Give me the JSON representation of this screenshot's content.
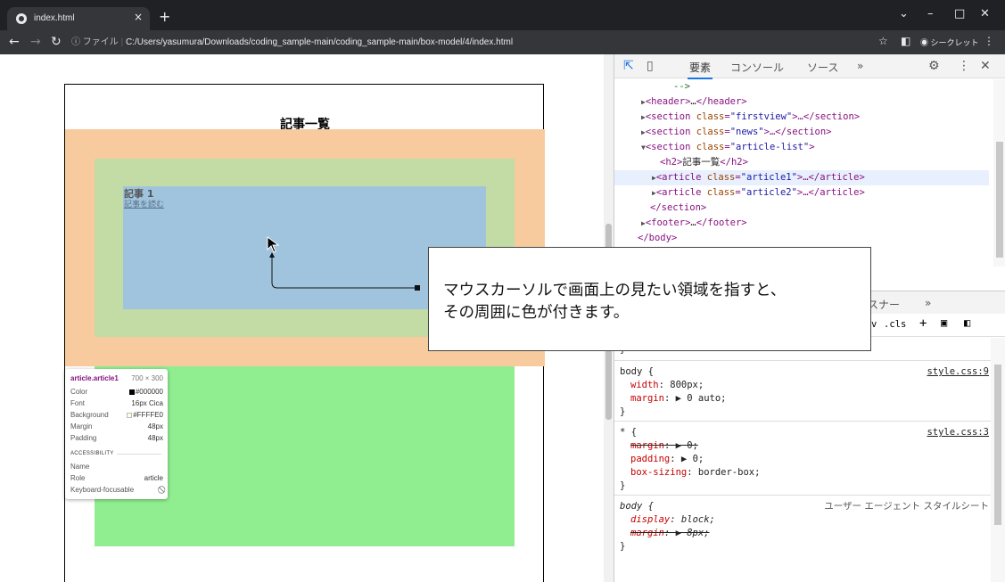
{
  "browser": {
    "tab_title": "index.html",
    "tab_close": "×",
    "new_tab": "+",
    "file_label": "ファイル",
    "url": "C:/Users/yasumura/Downloads/coding_sample-main/coding_sample-main/box-model/4/index.html",
    "incognito_label": "シークレット"
  },
  "page": {
    "heading": "記事一覧",
    "article_title": "記事 1",
    "article_link": "記事を読む"
  },
  "tooltip": {
    "selector": "article.article1",
    "size": "700 × 300",
    "rows": [
      {
        "k": "Color",
        "v": "#000000",
        "swatch": "#000000"
      },
      {
        "k": "Font",
        "v": "16px Cica"
      },
      {
        "k": "Background",
        "v": "#FFFFE0",
        "swatch": "#FFFFE0"
      },
      {
        "k": "Margin",
        "v": "48px"
      },
      {
        "k": "Padding",
        "v": "48px"
      }
    ],
    "accessibility_header": "ACCESSIBILITY",
    "a11y": [
      {
        "k": "Name",
        "v": ""
      },
      {
        "k": "Role",
        "v": "article"
      },
      {
        "k": "Keyboard-focusable",
        "v": "⃠"
      }
    ]
  },
  "devtools": {
    "tabs": [
      "要素",
      "コンソール",
      "ソース"
    ],
    "more": "»",
    "styles_tab_fragment": "リスナー",
    "styles_more": "»",
    "filter_cls": ".cls",
    "filter_hov": "v",
    "elements": [
      {
        "indent": 5,
        "kind": "comment",
        "text": "-->"
      },
      {
        "indent": 2,
        "kind": "node",
        "tri": "▶",
        "pre": "<header>",
        "mid": "…",
        "post": "</header>"
      },
      {
        "indent": 2,
        "kind": "attrnode",
        "tri": "▶",
        "tag": "section",
        "attr": "class",
        "val": "\"firstview\"",
        "post": ">…</section>"
      },
      {
        "indent": 2,
        "kind": "attrnode",
        "tri": "▶",
        "tag": "section",
        "attr": "class",
        "val": "\"news\"",
        "post": ">…</section>"
      },
      {
        "indent": 2,
        "kind": "attrnode",
        "tri": "▼",
        "tag": "section",
        "attr": "class",
        "val": "\"article-list\"",
        "post": ">"
      },
      {
        "indent": 4,
        "kind": "textnode",
        "tri": "",
        "pre": "<h2>",
        "mid": "記事一覧",
        "post": "</h2>"
      },
      {
        "indent": 4,
        "kind": "attrnode",
        "tri": "▶",
        "tag": "article",
        "attr": "class",
        "val": "\"article1\"",
        "post": ">…</article>",
        "selected": true
      },
      {
        "indent": 4,
        "kind": "attrnode",
        "tri": "▶",
        "tag": "article",
        "attr": "class",
        "val": "\"article2\"",
        "post": ">…</article>"
      },
      {
        "indent": 3,
        "kind": "node",
        "tri": "",
        "pre": "</section>",
        "mid": "",
        "post": ""
      },
      {
        "indent": 2,
        "kind": "node",
        "tri": "▶",
        "pre": "<footer>",
        "mid": "…",
        "post": "</footer>"
      },
      {
        "indent": 2,
        "kind": "node",
        "tri": "",
        "pre": "</body>",
        "mid": "",
        "post": ""
      }
    ],
    "rules": [
      {
        "lines": [
          {
            "t": "}",
            "cls": ""
          }
        ],
        "source": "",
        "top_pad": true
      },
      {
        "selector": "body {",
        "source": "style.css:9",
        "props": [
          {
            "name": "width",
            "value": "800px;",
            "strike": false
          },
          {
            "name": "margin",
            "value": "▶ 0 auto;",
            "strike": false
          }
        ]
      },
      {
        "selector": "* {",
        "source": "style.css:3",
        "props": [
          {
            "name": "margin",
            "value": "▶ 0;",
            "strike": true
          },
          {
            "name": "padding",
            "value": "▶ 0;",
            "strike": false
          },
          {
            "name": "box-sizing",
            "value": "border-box;",
            "strike": false
          }
        ]
      },
      {
        "selector": "body {",
        "source": "ユーザー エージェント スタイルシート",
        "ua": true,
        "props": [
          {
            "name": "display",
            "value": "block;",
            "strike": false
          },
          {
            "name": "margin",
            "value": "▶ 8px;",
            "strike": true
          }
        ]
      }
    ]
  },
  "callout": {
    "line1": "マウスカーソルで画面上の見たい領域を指すと、",
    "line2": "その周囲に色が付きます。"
  },
  "colors": {
    "margin_box": "#f8cb9e",
    "padding_box": "#c3dba4",
    "content_box": "#a0c4dd",
    "article2_bg": "#90ee90"
  }
}
